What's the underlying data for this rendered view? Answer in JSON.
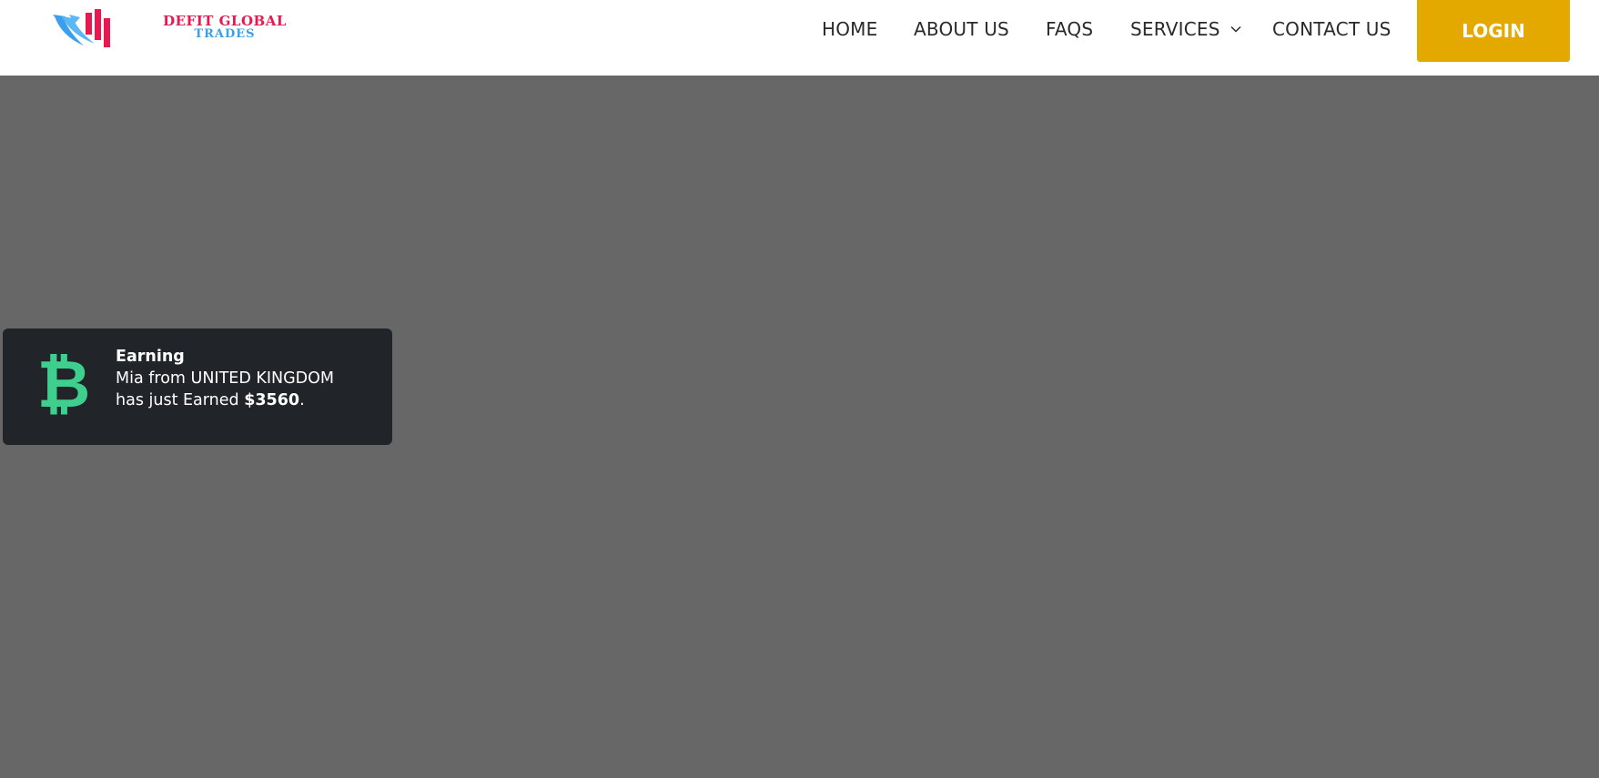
{
  "logo": {
    "line1": "DEFIT GLOBAL",
    "line2": "TRADES",
    "icon": "rising-bars-arrow-icon"
  },
  "nav": {
    "items": [
      {
        "label": "HOME"
      },
      {
        "label": "ABOUT US"
      },
      {
        "label": "FAQS"
      },
      {
        "label": "SERVICES",
        "has_dropdown": true,
        "dropdown_icon": "chevron-down-icon"
      },
      {
        "label": "CONTACT US"
      }
    ],
    "login_label": "LOGIN"
  },
  "toast": {
    "icon": "bitcoin-icon",
    "title": "Earning",
    "line1": "Mia from UNITED KINGDOM",
    "line2_prefix": "has just Earned ",
    "amount": "$3560",
    "line2_suffix": "."
  },
  "colors": {
    "header_bg": "#ffffff",
    "page_bg": "#676767",
    "login_bg": "#e3a900",
    "toast_bg": "#212529",
    "bitcoin_green": "#3ecf8e",
    "logo_red": "#e8194f",
    "logo_blue": "#3aa0ee"
  }
}
